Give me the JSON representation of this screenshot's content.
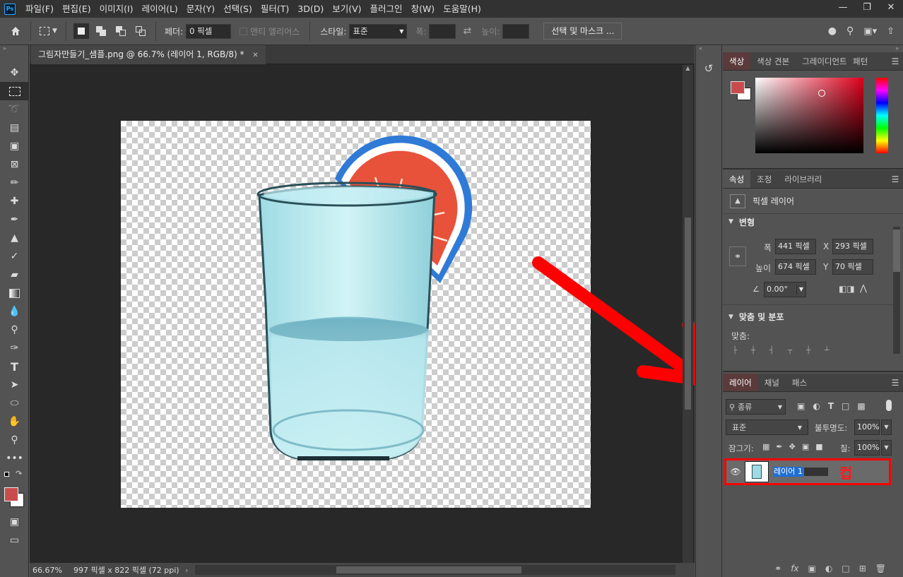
{
  "menubar": {
    "items": [
      "파일(F)",
      "편집(E)",
      "이미지(I)",
      "레이어(L)",
      "문자(Y)",
      "선택(S)",
      "필터(T)",
      "3D(D)",
      "보기(V)",
      "플러그인",
      "창(W)",
      "도움말(H)"
    ],
    "logo": "Ps"
  },
  "options": {
    "feather_label": "페더:",
    "feather_value": "0 픽셀",
    "antialias_label": "앤티 앨리어스",
    "style_label": "스타일:",
    "style_value": "표준",
    "width_label": "폭:",
    "height_label": "높이:",
    "select_mask_label": "선택 및 마스크 ..."
  },
  "document": {
    "tab_title": "그림자만들기_샘플.png @ 66.7% (레이어 1, RGB/8) *",
    "zoom": "66.67%",
    "doc_info": "997 픽셀 x 822 픽셀 (72 ppi)"
  },
  "color_panel": {
    "tabs": [
      "색상",
      "색상 견본",
      "그레이디언트",
      "패턴"
    ],
    "foreground": "#c94c4c",
    "background": "#ffffff"
  },
  "properties_panel": {
    "tabs": [
      "속성",
      "조정",
      "라이브러리"
    ],
    "layer_type": "픽셀 레이어",
    "transform_title": "변형",
    "width_label": "폭",
    "width_value": "441 픽셀",
    "height_label": "높이",
    "height_value": "674 픽셀",
    "x_label": "X",
    "x_value": "293 픽셀",
    "y_label": "Y",
    "y_value": "70 픽셀",
    "angle_value": "0.00°",
    "align_title": "맞춤 및 분포",
    "align_label": "맞춤:"
  },
  "layers_panel": {
    "tabs": [
      "레이어",
      "채널",
      "패스"
    ],
    "filter_kind": "종류",
    "blend_mode": "표준",
    "opacity_label": "불투명도:",
    "opacity_value": "100%",
    "lock_label": "잠그기:",
    "fill_label": "칠:",
    "fill_value": "100%",
    "layer_name": "레이어 1",
    "annotation": "컵"
  },
  "colors": {
    "accent_red": "#ff0000",
    "selection_blue": "#1f6fd6"
  }
}
